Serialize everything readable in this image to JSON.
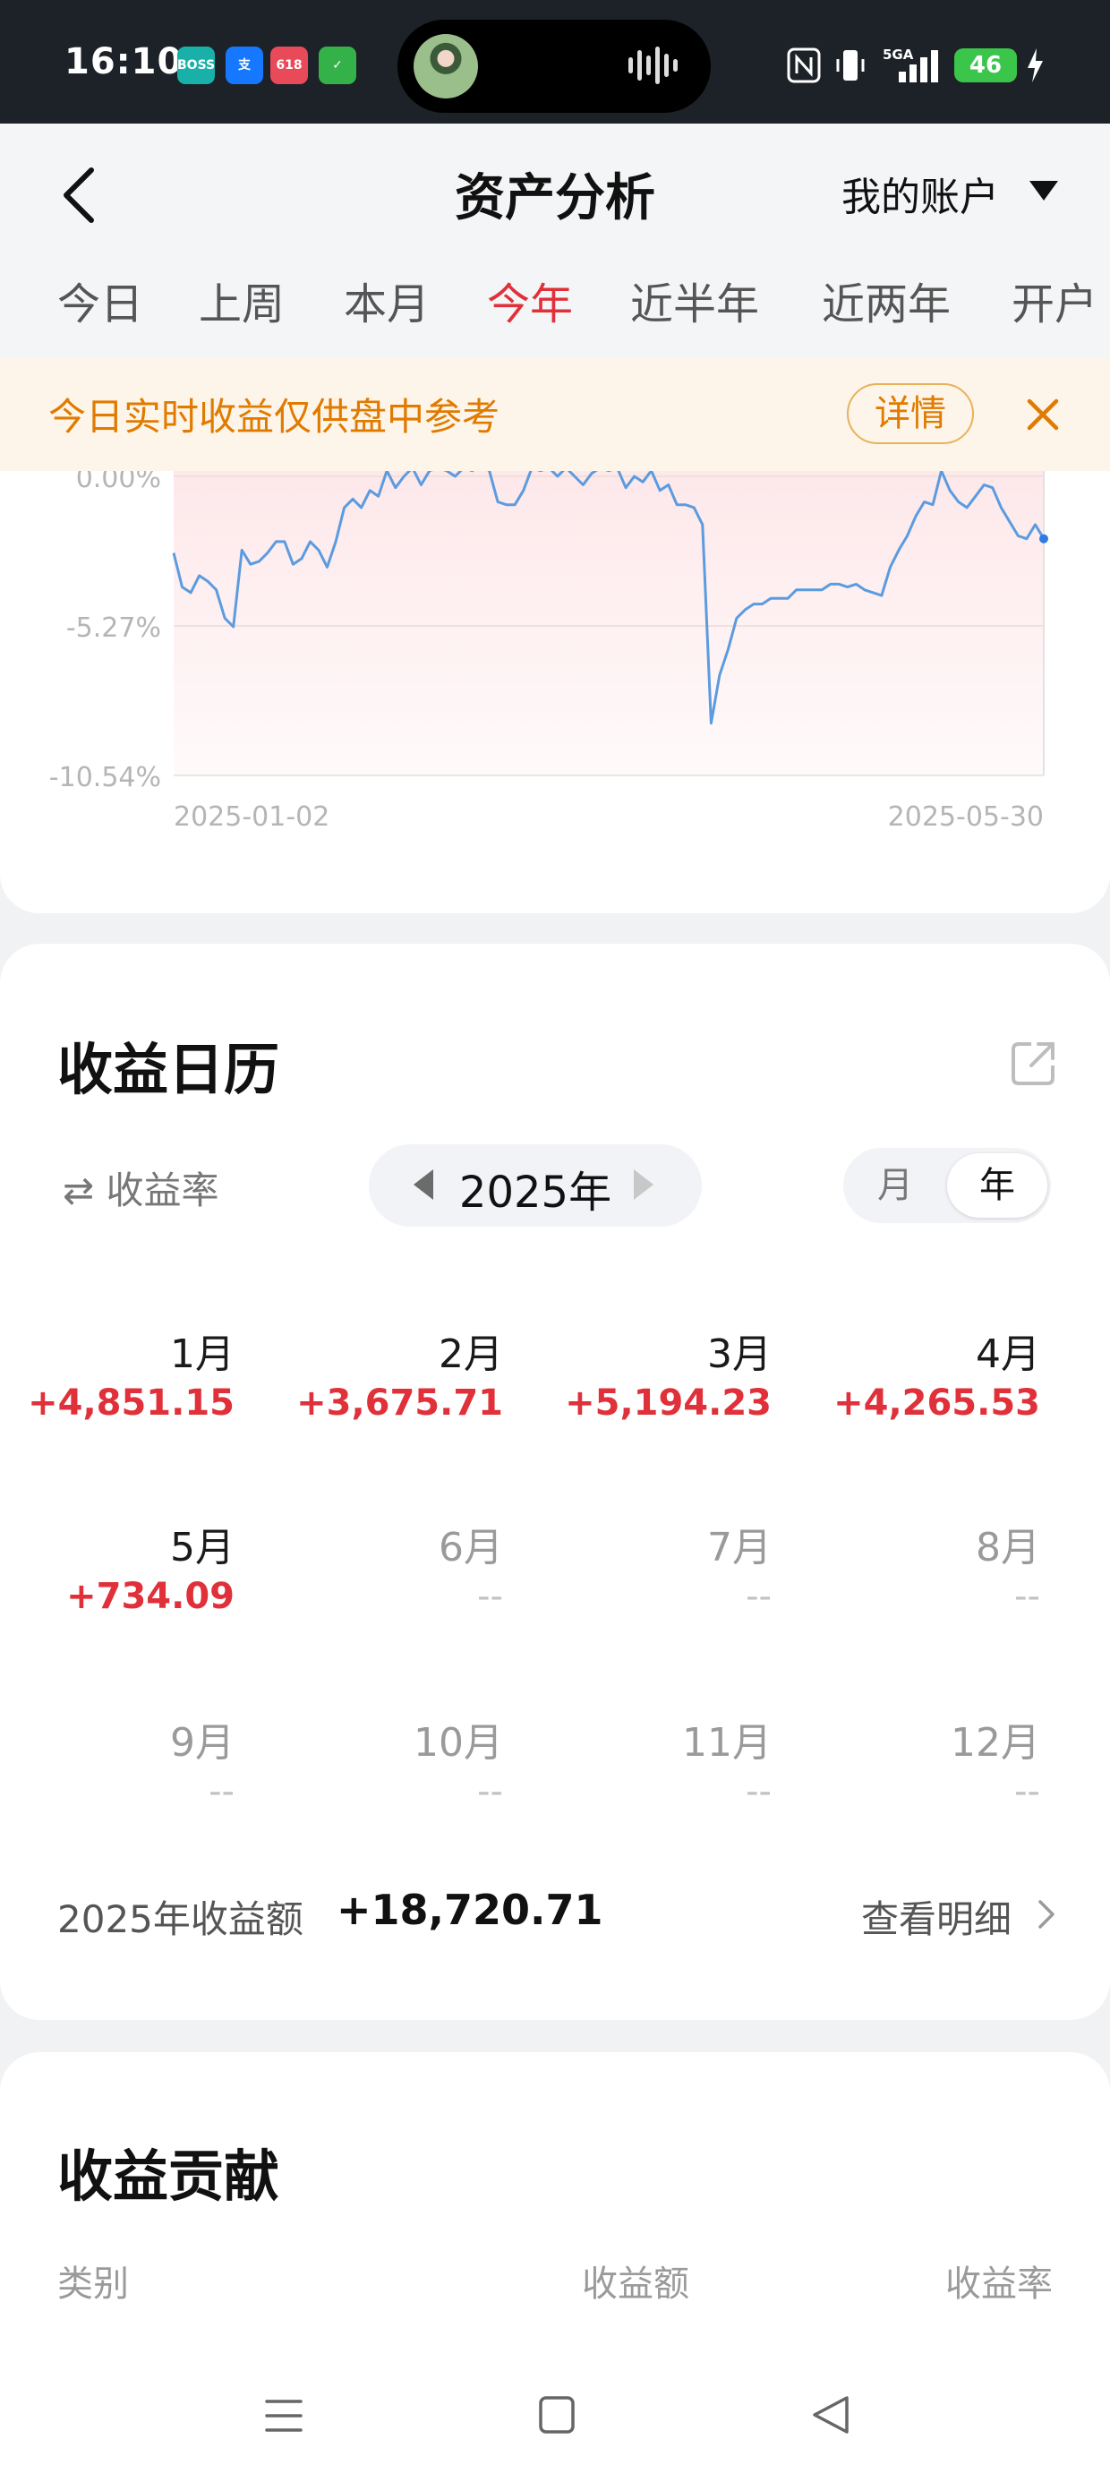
{
  "status_bar": {
    "time": "16:10",
    "apps": [
      {
        "icon": "boss-zhipin-app-icon",
        "label": "BOSS直聘",
        "color": "#18b0a8"
      },
      {
        "icon": "alipay-app-icon",
        "label": "支",
        "color": "#1677ff"
      },
      {
        "icon": "taobao-618-app-icon",
        "label": "618",
        "color": "#e94a5a"
      },
      {
        "icon": "green-app-icon",
        "label": "",
        "color": "#35b14a"
      }
    ],
    "network": "5GA",
    "battery": "46"
  },
  "header": {
    "title": "资产分析",
    "account": "我的账户"
  },
  "tabs": [
    {
      "label": "今日",
      "active": false
    },
    {
      "label": "上周",
      "active": false
    },
    {
      "label": "本月",
      "active": false
    },
    {
      "label": "今年",
      "active": true
    },
    {
      "label": "近半年",
      "active": false
    },
    {
      "label": "近两年",
      "active": false
    },
    {
      "label": "开户",
      "active": false
    }
  ],
  "notice": {
    "text": "今日实时收益仅供盘中参考",
    "button": "详情"
  },
  "chart_data": {
    "type": "line",
    "y_ticks": [
      "0.00%",
      "-5.27%",
      "-10.54%"
    ],
    "ylim": [
      -10.54,
      0.0
    ],
    "x_ticks": [
      "2025-01-02",
      "2025-05-30"
    ],
    "series_color": "#5b9be0",
    "grid": true,
    "values": [
      -2.7,
      -3.9,
      -4.1,
      -3.5,
      -3.7,
      -4.0,
      -5.0,
      -5.3,
      -2.6,
      -3.1,
      -3.0,
      -2.7,
      -2.3,
      -2.3,
      -3.1,
      -2.9,
      -2.3,
      -2.6,
      -3.2,
      -2.3,
      -1.1,
      -0.8,
      -1.1,
      -0.5,
      -0.7,
      0.2,
      -0.4,
      0.0,
      0.3,
      -0.3,
      0.2,
      0.3,
      0.2,
      0.0,
      0.3,
      0.2,
      0.4,
      0.2,
      -0.9,
      -1.0,
      -1.0,
      -0.5,
      0.3,
      0.2,
      0.3,
      0.0,
      0.3,
      0.0,
      -0.3,
      0.1,
      0.3,
      0.2,
      0.3,
      -0.4,
      0.0,
      -0.2,
      0.2,
      -0.5,
      -0.3,
      -1.0,
      -1.0,
      -1.1,
      -1.7,
      -8.7,
      -7.0,
      -6.1,
      -5.0,
      -4.7,
      -4.5,
      -4.5,
      -4.3,
      -4.3,
      -4.3,
      -4.0,
      -4.0,
      -4.0,
      -4.0,
      -3.8,
      -3.8,
      -3.9,
      -3.8,
      -4.0,
      -4.1,
      -4.2,
      -3.2,
      -2.6,
      -2.1,
      -1.4,
      -0.9,
      -1.0,
      0.2,
      -0.5,
      -0.9,
      -1.1,
      -0.7,
      -0.3,
      -0.4,
      -1.1,
      -1.6,
      -2.1,
      -2.2,
      -1.7,
      -2.2
    ]
  },
  "calendar": {
    "title": "收益日历",
    "rate_toggle": "收益率",
    "year": "2025年",
    "segments": {
      "month": "月",
      "year": "年"
    },
    "months": [
      {
        "name": "1月",
        "value": "+4,851.15",
        "has_value": true
      },
      {
        "name": "2月",
        "value": "+3,675.71",
        "has_value": true
      },
      {
        "name": "3月",
        "value": "+5,194.23",
        "has_value": true
      },
      {
        "name": "4月",
        "value": "+4,265.53",
        "has_value": true
      },
      {
        "name": "5月",
        "value": "+734.09",
        "has_value": true
      },
      {
        "name": "6月",
        "value": "--",
        "has_value": false
      },
      {
        "name": "7月",
        "value": "--",
        "has_value": false
      },
      {
        "name": "8月",
        "value": "--",
        "has_value": false
      },
      {
        "name": "9月",
        "value": "--",
        "has_value": false
      },
      {
        "name": "10月",
        "value": "--",
        "has_value": false
      },
      {
        "name": "11月",
        "value": "--",
        "has_value": false
      },
      {
        "name": "12月",
        "value": "--",
        "has_value": false
      }
    ],
    "total_label": "2025年收益额",
    "total_value": "+18,720.71",
    "detail_link": "查看明细"
  },
  "contribution": {
    "title": "收益贡献",
    "columns": [
      "类别",
      "收益额",
      "收益率"
    ]
  },
  "colors": {
    "accent_red": "#e0313a",
    "notice_orange": "#e07b00",
    "line_blue": "#5b9be0"
  }
}
